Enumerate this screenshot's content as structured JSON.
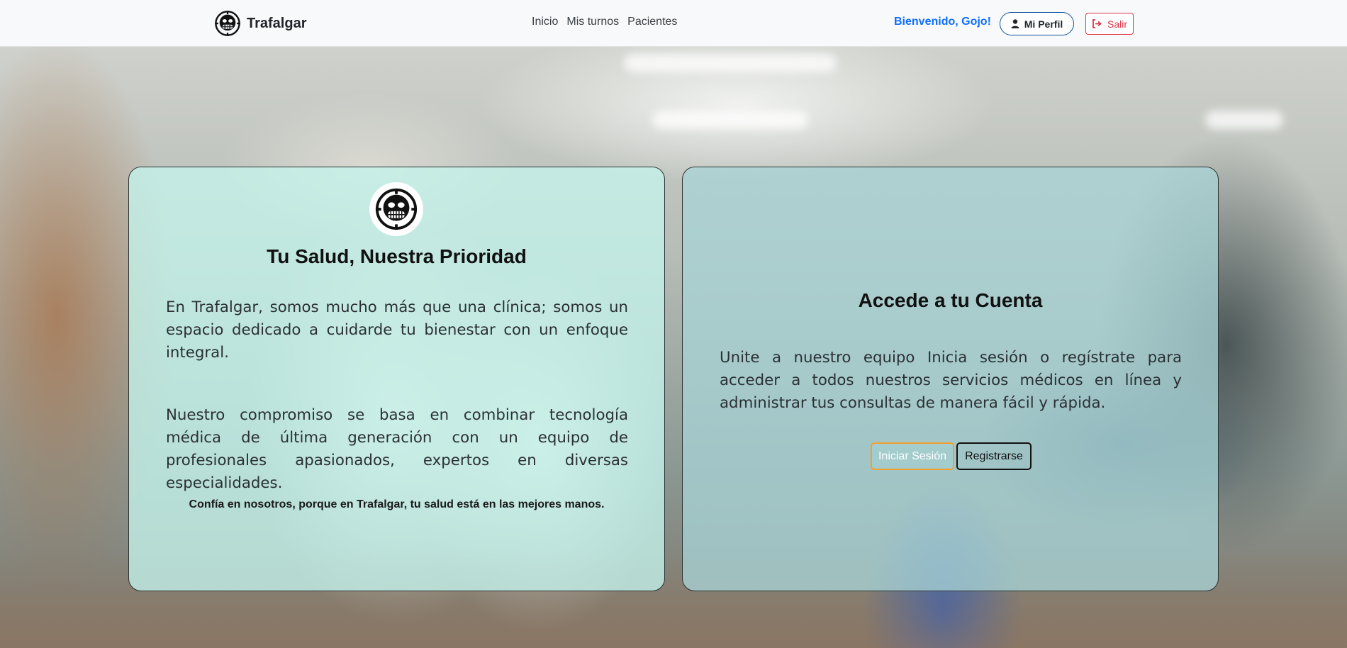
{
  "navbar": {
    "brand_name": "Trafalgar",
    "brand_icon": "jolly-roger-smile-icon",
    "links": [
      {
        "label": "Inicio"
      },
      {
        "label": "Mis turnos"
      },
      {
        "label": "Pacientes"
      }
    ],
    "welcome_text": "Bienvenido, Gojo!",
    "profile_button": {
      "label": "Mi Perfil",
      "icon": "user-icon"
    },
    "logout_button": {
      "label": "Salir",
      "icon": "sign-out-icon"
    }
  },
  "left_card": {
    "logo_icon": "jolly-roger-smile-icon",
    "title": "Tu Salud, Nuestra Prioridad",
    "paragraph_1": "En Trafalgar, somos mucho más que una clínica; somos un espacio dedicado a cuidarde tu bienestar con un enfoque integral.",
    "paragraph_2": "Nuestro compromiso se basa en combinar tecnología médica de última generación con un equipo de profesionales apasionados, expertos en diversas especialidades.",
    "tagline": "Confía en nosotros, porque en Trafalgar, tu salud está en las mejores manos."
  },
  "right_card": {
    "title": "Accede a tu Cuenta",
    "paragraph": "Unite a nuestro equipo Inicia sesión o regístrate para acceder a todos nuestros servicios médicos en línea y administrar tus consultas de manera fácil y rápida.",
    "login_button": "Iniciar Sesión",
    "register_button": "Registrarse"
  },
  "colors": {
    "primary": "#0d6efd",
    "danger": "#dc3545",
    "login_border": "#f0a030",
    "card_left_bg": "#c4f4ec",
    "card_right_bg": "#a8d4d6"
  }
}
